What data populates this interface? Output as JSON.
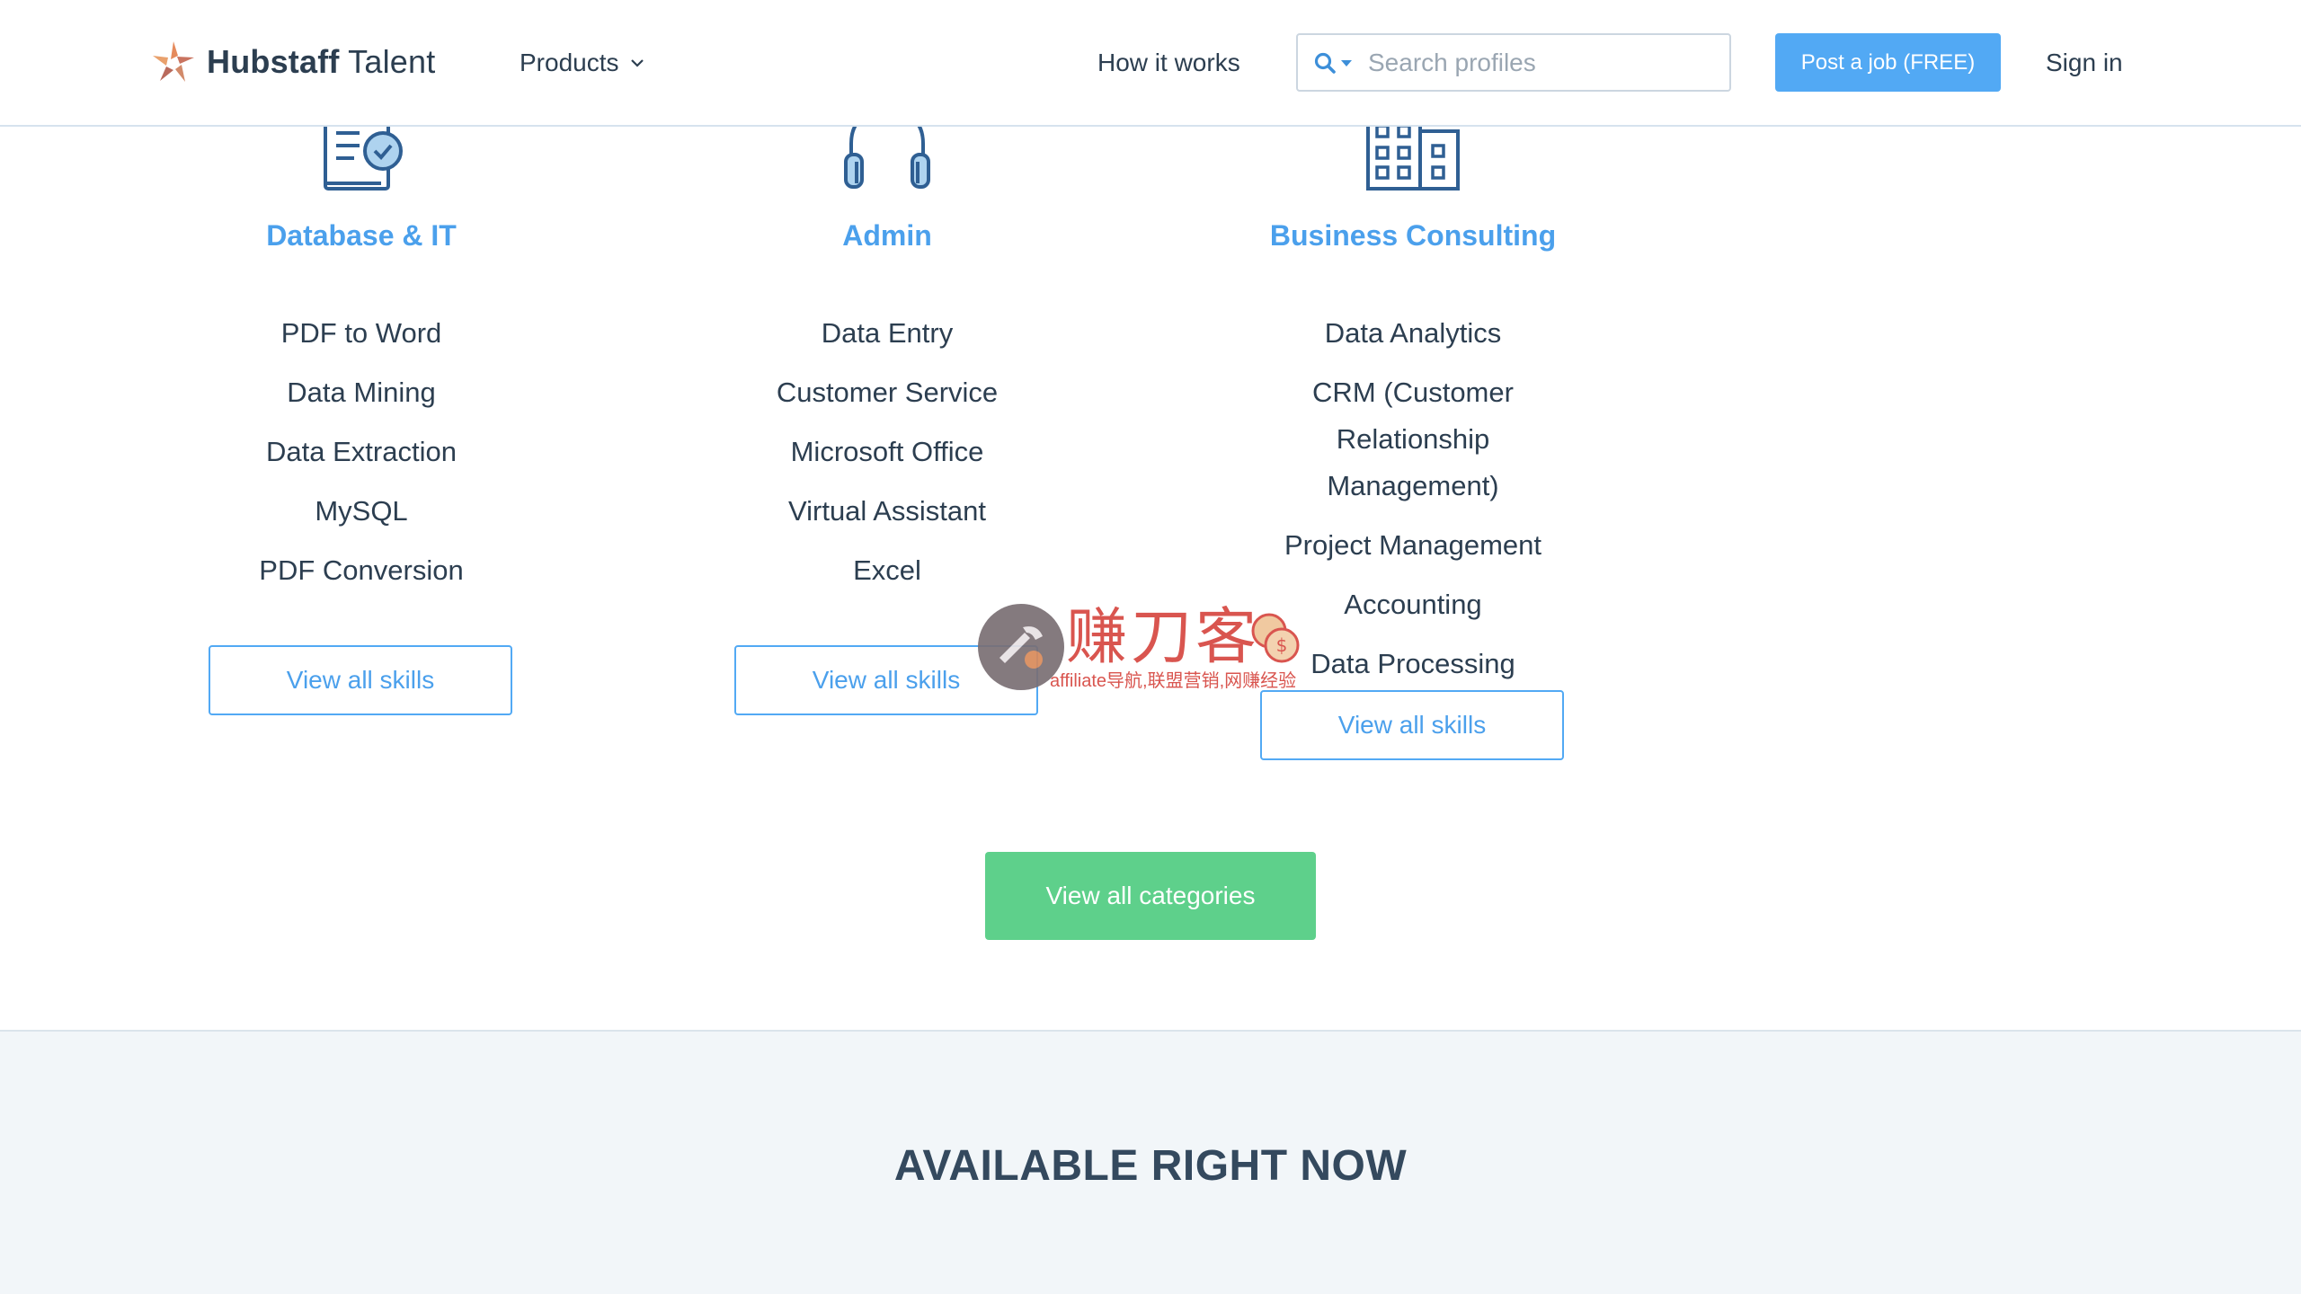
{
  "header": {
    "logo_text_bold": "Hubstaff",
    "logo_text_light": "Talent",
    "products_label": "Products",
    "how_it_works_label": "How it works",
    "search_placeholder": "Search profiles",
    "post_job_label": "Post a job (FREE)",
    "sign_in_label": "Sign in"
  },
  "categories": [
    {
      "title": "Database & IT",
      "icon": "database-document-icon",
      "skills": [
        "PDF to Word",
        "Data Mining",
        "Data Extraction",
        "MySQL",
        "PDF Conversion"
      ],
      "button_label": "View all skills"
    },
    {
      "title": "Admin",
      "icon": "headphones-icon",
      "skills": [
        "Data Entry",
        "Customer Service",
        "Microsoft Office",
        "Virtual Assistant",
        "Excel"
      ],
      "button_label": "View all skills"
    },
    {
      "title": "Business Consulting",
      "icon": "office-building-icon",
      "skills": [
        "Data Analytics",
        "CRM (Customer Relationship Management)",
        "Project Management",
        "Accounting",
        "Data Processing"
      ],
      "button_label": "View all skills"
    }
  ],
  "view_all_categories_label": "View all categories",
  "available_heading": "AVAILABLE RIGHT NOW",
  "watermark": {
    "chinese": "赚刀客",
    "subtitle": "affiliate导航,联盟营销,网赚经验"
  },
  "colors": {
    "accent_blue": "#52a9f4",
    "category_title_blue": "#4ba0ec",
    "green_button": "#5ed08b",
    "text_dark": "#2c3e50",
    "section_bg": "#f2f6f9"
  }
}
